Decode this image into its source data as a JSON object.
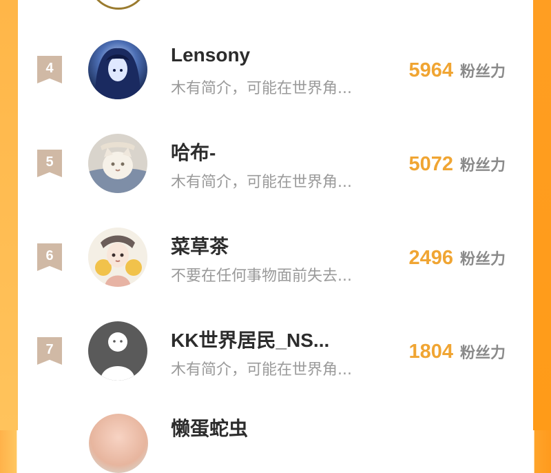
{
  "entries": [
    {
      "rank": "4",
      "name": "Lensony",
      "bio": "木有简介，可能在世界角...",
      "fans_count": "5964",
      "fans_label": "粉丝力"
    },
    {
      "rank": "5",
      "name": "哈布-",
      "bio": "木有简介，可能在世界角...",
      "fans_count": "5072",
      "fans_label": "粉丝力"
    },
    {
      "rank": "6",
      "name": "菜草茶",
      "bio": "不要在任何事物面前失去...",
      "fans_count": "2496",
      "fans_label": "粉丝力"
    },
    {
      "rank": "7",
      "name": "KK世界居民_NS...",
      "bio": "木有简介，可能在世界角...",
      "fans_count": "1804",
      "fans_label": "粉丝力"
    }
  ],
  "partial_bottom_name": "懒蛋蛇虫"
}
